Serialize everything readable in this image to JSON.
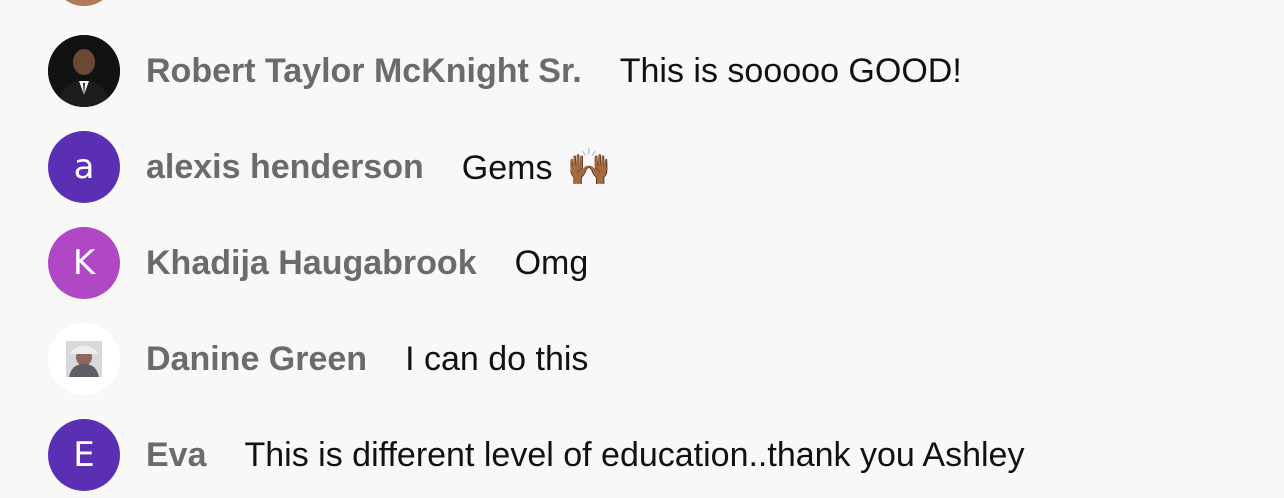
{
  "comments": [
    {
      "avatar_type": "photo",
      "avatar_icon": "person-photo-icon",
      "name": "Robert Taylor McKnight Sr.",
      "message": "This is sooooo GOOD!"
    },
    {
      "avatar_type": "initial",
      "avatar_letter": "a",
      "avatar_color": "#5a2fb3",
      "name": "alexis henderson",
      "message": "Gems",
      "emoji": "🙌🏾"
    },
    {
      "avatar_type": "initial",
      "avatar_letter": "K",
      "avatar_color": "#b047c4",
      "name": "Khadija Haugabrook",
      "message": "Omg"
    },
    {
      "avatar_type": "photo",
      "avatar_icon": "person-photo-icon",
      "name": "Danine Green",
      "message": "I can do this"
    },
    {
      "avatar_type": "initial",
      "avatar_letter": "E",
      "avatar_color": "#5a2fb3",
      "name": "Eva",
      "message": "This is different level of education..thank you Ashley"
    }
  ]
}
